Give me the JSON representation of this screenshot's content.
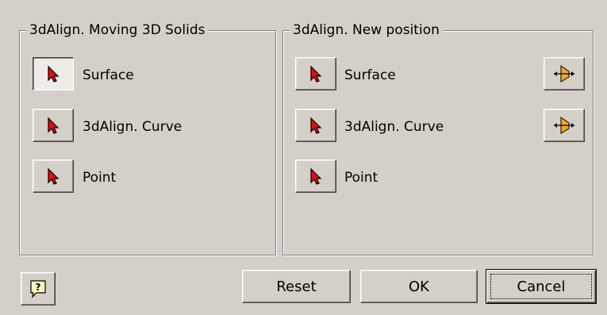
{
  "left_group": {
    "title": "3dAlign. Moving 3D Solids",
    "items": [
      {
        "label": "Surface",
        "icon": "red-arrow-cursor-icon"
      },
      {
        "label": "3dAlign. Curve",
        "icon": "red-arrow-cursor-icon"
      },
      {
        "label": "Point",
        "icon": "red-arrow-cursor-icon"
      }
    ]
  },
  "right_group": {
    "title": "3dAlign. New position",
    "items": [
      {
        "label": "Surface",
        "icon": "red-arrow-cursor-icon",
        "flip_icon": "flip-direction-icon"
      },
      {
        "label": "3dAlign. Curve",
        "icon": "red-arrow-cursor-icon",
        "flip_icon": "flip-direction-icon"
      },
      {
        "label": "Point",
        "icon": "red-arrow-cursor-icon"
      }
    ]
  },
  "footer": {
    "help_icon": "help-icon",
    "reset_label": "Reset",
    "ok_label": "OK",
    "cancel_label": "Cancel"
  },
  "colors": {
    "dialog_bg": "#d4d0c8",
    "cursor_red": "#e01010",
    "flip_orange": "#f5a623"
  }
}
